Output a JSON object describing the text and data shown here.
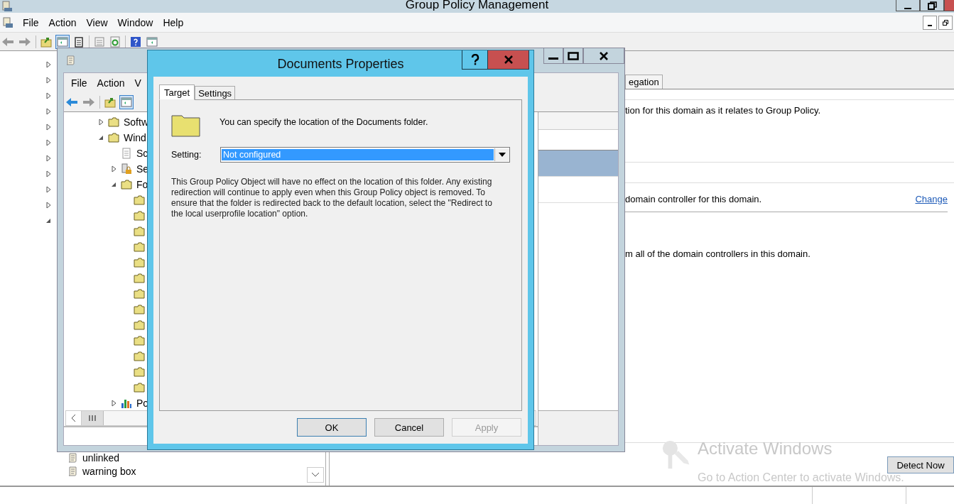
{
  "main_window": {
    "title": "Group Policy Management",
    "menu": [
      "File",
      "Action",
      "View",
      "Window",
      "Help"
    ]
  },
  "tree_expanders": [
    {
      "expanded": false
    },
    {
      "expanded": false
    },
    {
      "expanded": false
    },
    {
      "expanded": false
    },
    {
      "expanded": false
    },
    {
      "expanded": false
    },
    {
      "expanded": false
    },
    {
      "expanded": false
    },
    {
      "expanded": false
    },
    {
      "expanded": false
    },
    {
      "expanded": true
    }
  ],
  "left_tree_items": [
    {
      "label": "unlinked"
    },
    {
      "label": "warning box"
    }
  ],
  "details": {
    "tab": "egation",
    "lines": [
      {
        "text": "tion for this domain as it relates to Group Policy."
      },
      {
        "text": "domain controller for this domain.",
        "link": "Change"
      },
      {
        "text": "m all of the domain controllers in this domain."
      }
    ],
    "button": "Detect Now"
  },
  "activation_notice": {
    "title": "Activate Windows",
    "message": "Go to Action Center to activate Windows."
  },
  "editor_window": {
    "menu": [
      "File",
      "Action",
      "V"
    ],
    "tree": [
      {
        "label": "Softw",
        "kind": "folder",
        "expanded": false
      },
      {
        "label": "Wind",
        "kind": "folder",
        "expanded": true,
        "children": [
          {
            "label": "Sc",
            "kind": "script"
          },
          {
            "label": "Se",
            "kind": "security",
            "expanded": false
          },
          {
            "label": "Fo",
            "kind": "folder",
            "expanded": true,
            "children": [
              {
                "kind": "folder"
              },
              {
                "kind": "folder"
              },
              {
                "kind": "folder"
              },
              {
                "kind": "folder"
              },
              {
                "kind": "folder"
              },
              {
                "kind": "folder"
              },
              {
                "kind": "folder"
              },
              {
                "kind": "folder"
              },
              {
                "kind": "folder"
              },
              {
                "kind": "folder"
              },
              {
                "kind": "folder"
              },
              {
                "kind": "folder"
              },
              {
                "kind": "folder"
              }
            ]
          },
          {
            "label": "Po",
            "kind": "chart",
            "expanded": false
          }
        ]
      }
    ],
    "list_rows": [
      {
        "selected": true
      },
      {
        "selected": false
      }
    ]
  },
  "dialog": {
    "title": "Documents Properties",
    "tabs": [
      {
        "label": "Target",
        "selected": true
      },
      {
        "label": "Settings",
        "selected": false
      }
    ],
    "intro": "You can specify the location of the Documents folder.",
    "setting_label": "Setting:",
    "setting_value": "Not configured",
    "description": "This Group Policy Object will have no effect on the location of this folder. Any existing redirection will continue to apply even when this Group Policy object is removed. To ensure that the folder is redirected back to the default location, select the \"Redirect to the local userprofile location\" option.",
    "buttons": [
      {
        "label": "OK",
        "disabled": false
      },
      {
        "label": "Cancel",
        "disabled": false
      },
      {
        "label": "Apply",
        "disabled": true
      }
    ]
  }
}
